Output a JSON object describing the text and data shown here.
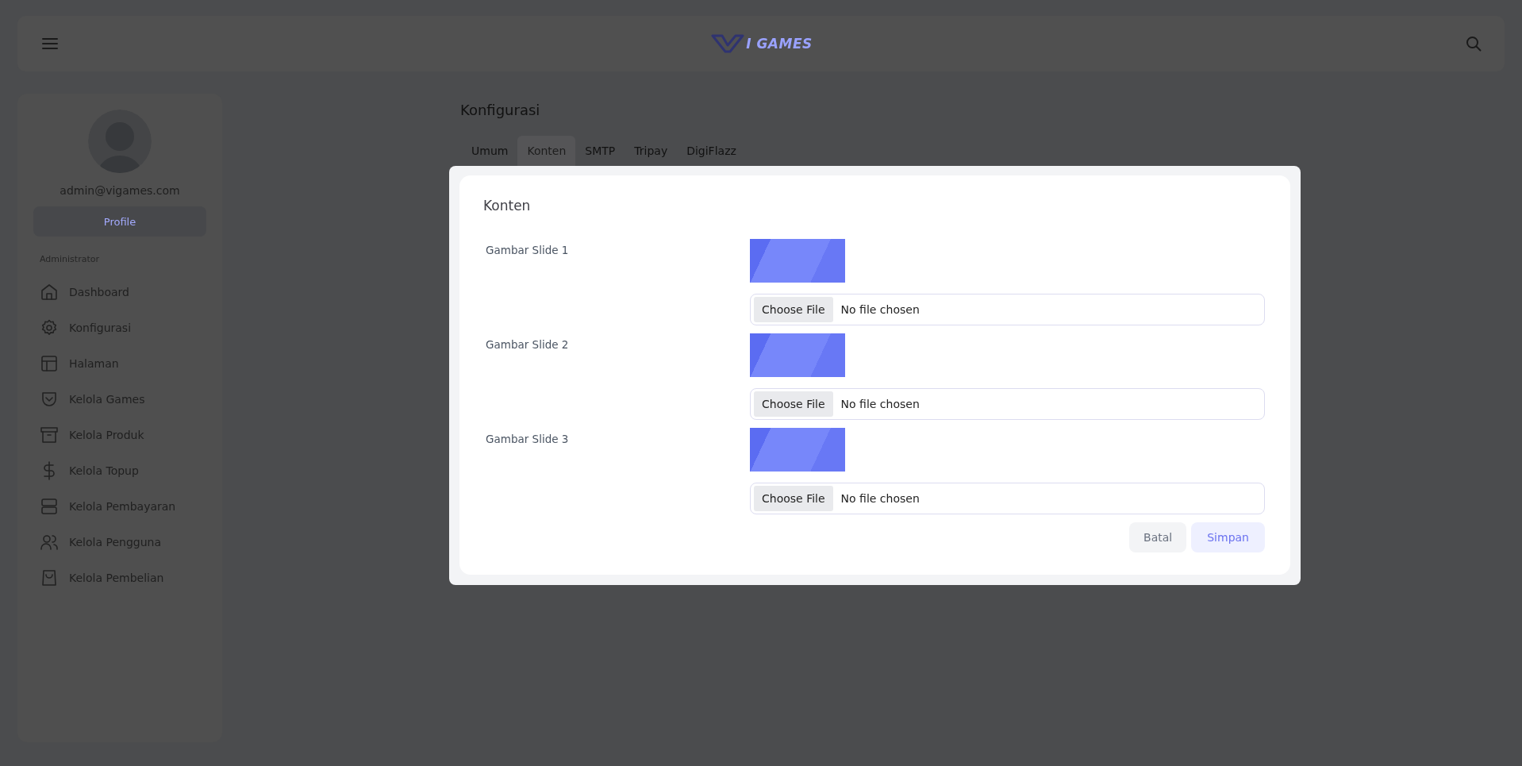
{
  "header": {
    "logo_text": "I GAMES"
  },
  "sidebar": {
    "email": "admin@vigames.com",
    "profile_button": "Profile",
    "section_label": "Administrator",
    "items": [
      {
        "label": "Dashboard"
      },
      {
        "label": "Konfigurasi"
      },
      {
        "label": "Halaman"
      },
      {
        "label": "Kelola Games"
      },
      {
        "label": "Kelola Produk"
      },
      {
        "label": "Kelola Topup"
      },
      {
        "label": "Kelola Pembayaran"
      },
      {
        "label": "Kelola Pengguna"
      },
      {
        "label": "Kelola Pembelian"
      }
    ]
  },
  "page_title": "Konfigurasi",
  "tabs": [
    {
      "label": "Umum",
      "selected": false
    },
    {
      "label": "Konten",
      "selected": true
    },
    {
      "label": "SMTP",
      "selected": false
    },
    {
      "label": "Tripay",
      "selected": false
    },
    {
      "label": "DigiFlazz",
      "selected": false
    }
  ],
  "modal": {
    "title": "Konten",
    "fields": [
      {
        "label": "Gambar Slide 1",
        "button": "Choose File",
        "status": "No file chosen"
      },
      {
        "label": "Gambar Slide 2",
        "button": "Choose File",
        "status": "No file chosen"
      },
      {
        "label": "Gambar Slide 3",
        "button": "Choose File",
        "status": "No file chosen"
      }
    ],
    "buttons": [
      {
        "label": "Batal",
        "kind": "secondary"
      },
      {
        "label": "Simpan",
        "kind": "primary"
      }
    ]
  }
}
